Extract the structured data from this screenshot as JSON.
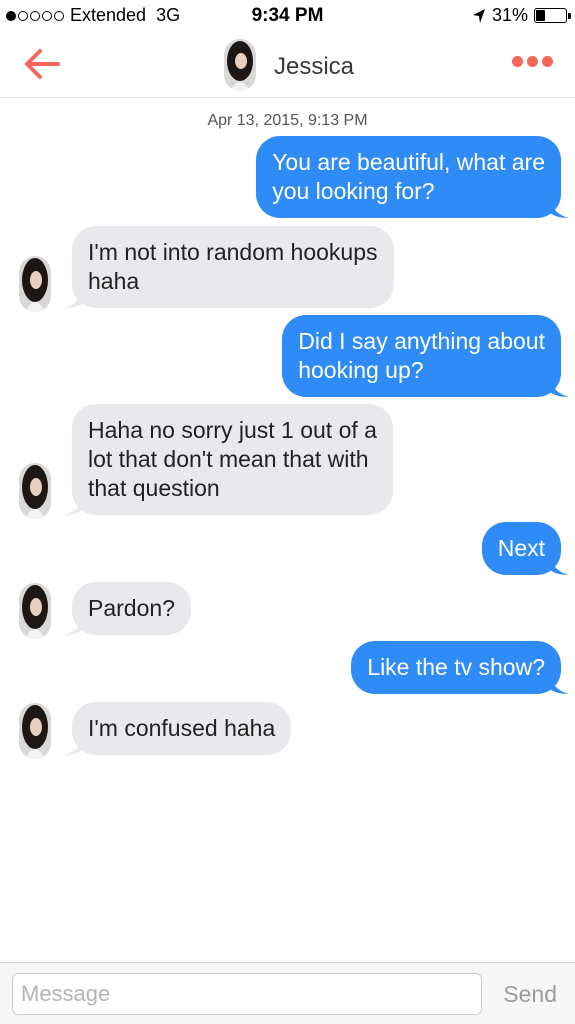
{
  "status_bar": {
    "signal_dots_filled": 1,
    "signal_dots_total": 5,
    "carrier": "Extended",
    "network": "3G",
    "time": "9:34 PM",
    "battery_percent": "31%",
    "battery_level": 0.31,
    "location_icon": "location-arrow-icon"
  },
  "nav": {
    "back_icon": "back-arrow-icon",
    "contact_name": "Jessica",
    "more_icon": "more-dots-icon",
    "accent_color": "#f4685a"
  },
  "thread": {
    "timestamp": "Apr 13, 2015, 9:13 PM",
    "messages": [
      {
        "direction": "sent",
        "lines": [
          "You are beautiful, what are",
          "you looking for?"
        ]
      },
      {
        "direction": "received",
        "lines": [
          "I'm not into random hookups",
          "haha"
        ]
      },
      {
        "direction": "sent",
        "lines": [
          "Did I say anything about",
          "hooking up?"
        ]
      },
      {
        "direction": "received",
        "lines": [
          "Haha no sorry just 1 out of a",
          "lot that don't mean that with",
          "that question"
        ]
      },
      {
        "direction": "sent",
        "lines": [
          "Next"
        ]
      },
      {
        "direction": "received",
        "lines": [
          "Pardon?"
        ]
      },
      {
        "direction": "sent",
        "lines": [
          "Like the tv show?"
        ]
      },
      {
        "direction": "received",
        "lines": [
          "I'm confused haha"
        ]
      }
    ]
  },
  "composer": {
    "placeholder": "Message",
    "value": "",
    "send_label": "Send"
  },
  "colors": {
    "sent_bubble": "#2f8cf6",
    "received_bubble": "#e9e9ed"
  }
}
